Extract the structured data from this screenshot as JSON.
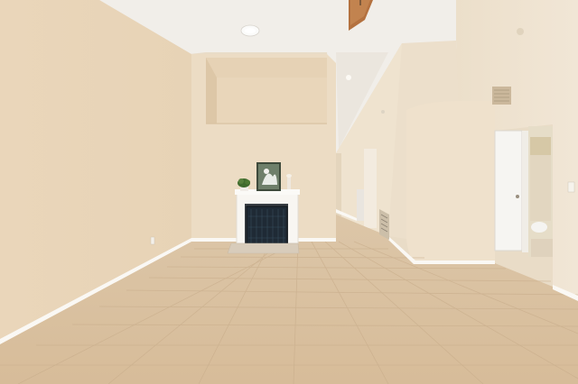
{
  "scene": {
    "description_free": true,
    "colors": {
      "ceiling": "#f2efe9",
      "wall_main": "#ecdcc4",
      "wall_shadow": "#e3d1b5",
      "wall_bright": "#f3e6d3",
      "floor_tile": "#d9c0a0",
      "floor_grout": "#c9ad8a",
      "baseboard": "#fbf9f5",
      "door": "#f6f5f2",
      "fireplace_surround": "#f8f6f2",
      "fireplace_screen": "#222a33",
      "fan_blade": "#b4713f"
    },
    "objects": [
      "ceiling-fan",
      "ceiling-light",
      "fireplace",
      "fireplace-screen",
      "hearth-mat",
      "artwork",
      "potted-plant",
      "floor-vent",
      "wall-vent",
      "white-door",
      "bathroom-doorway",
      "hallway"
    ]
  }
}
